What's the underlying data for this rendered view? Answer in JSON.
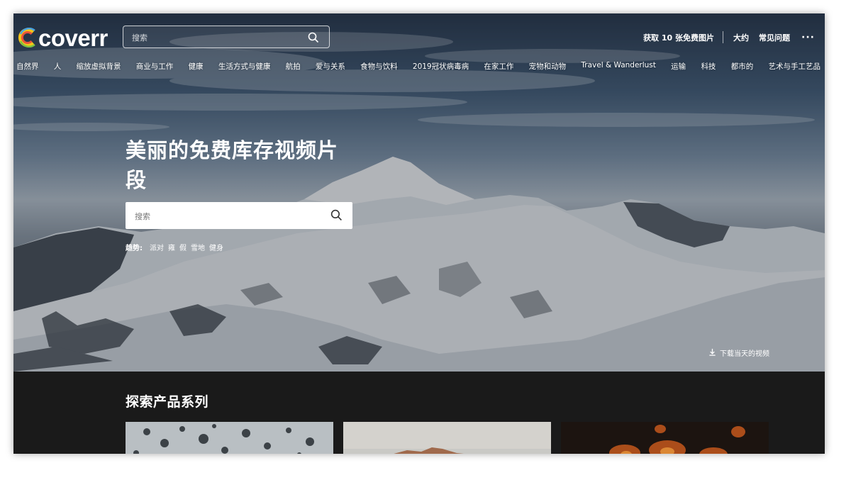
{
  "brand": {
    "logo_text": "coverr"
  },
  "header": {
    "search_placeholder": "搜索",
    "links": [
      {
        "label": "获取 10 张免费图片"
      },
      {
        "label": "大约"
      },
      {
        "label": "常见问题"
      }
    ],
    "more_label": "···"
  },
  "categories": [
    {
      "label": "自然界"
    },
    {
      "label": "人"
    },
    {
      "label": "缩放虚拟背景"
    },
    {
      "label": "商业与工作"
    },
    {
      "label": "健康"
    },
    {
      "label": "生活方式与健康"
    },
    {
      "label": "航拍"
    },
    {
      "label": "爱与关系"
    },
    {
      "label": "食物与饮料"
    },
    {
      "label": "2019冠状病毒病"
    },
    {
      "label": "在家工作"
    },
    {
      "label": "宠物和动物"
    },
    {
      "label": "Travel & Wanderlust"
    },
    {
      "label": "运输"
    },
    {
      "label": "科技"
    },
    {
      "label": "都市的"
    },
    {
      "label": "艺术与手工艺品"
    }
  ],
  "hero": {
    "headline": "美丽的免费库存视频片段",
    "search_placeholder": "搜索",
    "trending_label": "趋势:",
    "trending_terms": [
      {
        "label": "派对"
      },
      {
        "label": "雍"
      },
      {
        "label": "假"
      },
      {
        "label": "雪地"
      },
      {
        "label": "健身"
      }
    ],
    "download_label": "下载当天的视频"
  },
  "collections": {
    "title": "探索产品系列"
  },
  "colors": {
    "logo_ring": [
      "#f5c518",
      "#e8533a",
      "#4aa3df",
      "#7ac143"
    ],
    "page_dark": "#1a1a1a"
  }
}
